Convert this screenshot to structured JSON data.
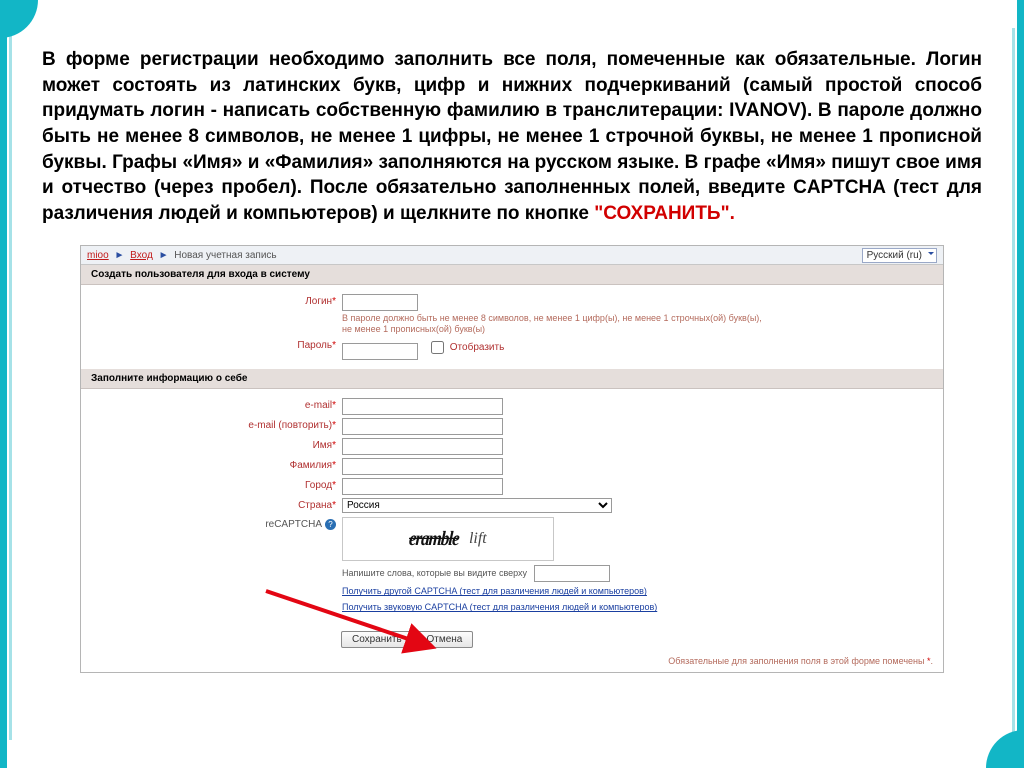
{
  "intro": {
    "text_main": "В форме регистрации необходимо заполнить все поля, помеченные как обязательные. Логин может состоять из латинских букв, цифр и нижних подчеркиваний (самый простой способ придумать логин - написать собственную фамилию в транслитерации: IVANOV). В пароле должно быть не менее 8 символов, не менее 1 цифры, не менее 1 строчной буквы, не менее 1 прописной буквы. Графы «Имя» и «Фамилия» заполняются на русском языке. В графе «Имя» пишут свое имя и отчество (через пробел). После обязательно заполненных полей, введите CAPTCHA (тест для различения людей и компьютеров) и  щелкните по кнопке ",
    "save_quoted": "\"СОХРАНИТЬ\"."
  },
  "breadcrumb": {
    "root": "mioo",
    "mid": "Вход",
    "cur": "Новая учетная запись"
  },
  "lang_selected": "Русский (ru)",
  "section1": "Создать пользователя для входа в систему",
  "section2": "Заполните информацию о себе",
  "fields": {
    "login": "Логин",
    "password": "Пароль",
    "show": "Отобразить",
    "pw_hint": "В пароле должно быть не менее 8 символов, не менее 1 цифр(ы), не менее 1 строчных(ой) букв(ы), не менее 1 прописных(ой) букв(ы)",
    "email": "e-mail",
    "email2": "e-mail (повторить)",
    "fname": "Имя",
    "lname": "Фамилия",
    "city": "Город",
    "country": "Страна",
    "country_value": "Россия",
    "recaptcha": "reCAPTCHA"
  },
  "captcha": {
    "word1": "eramble",
    "word2": "lift",
    "instr": "Напишите слова, которые вы видите сверху",
    "link1": "Получить другой CAPTCHA (тест для различения людей и компьютеров)",
    "link2": "Получить звуковую CAPTCHA (тест для различения людей и компьютеров)"
  },
  "buttons": {
    "save": "Сохранить",
    "cancel": "Отмена"
  },
  "footnote": "Обязательные для заполнения поля в этой форме помечены "
}
